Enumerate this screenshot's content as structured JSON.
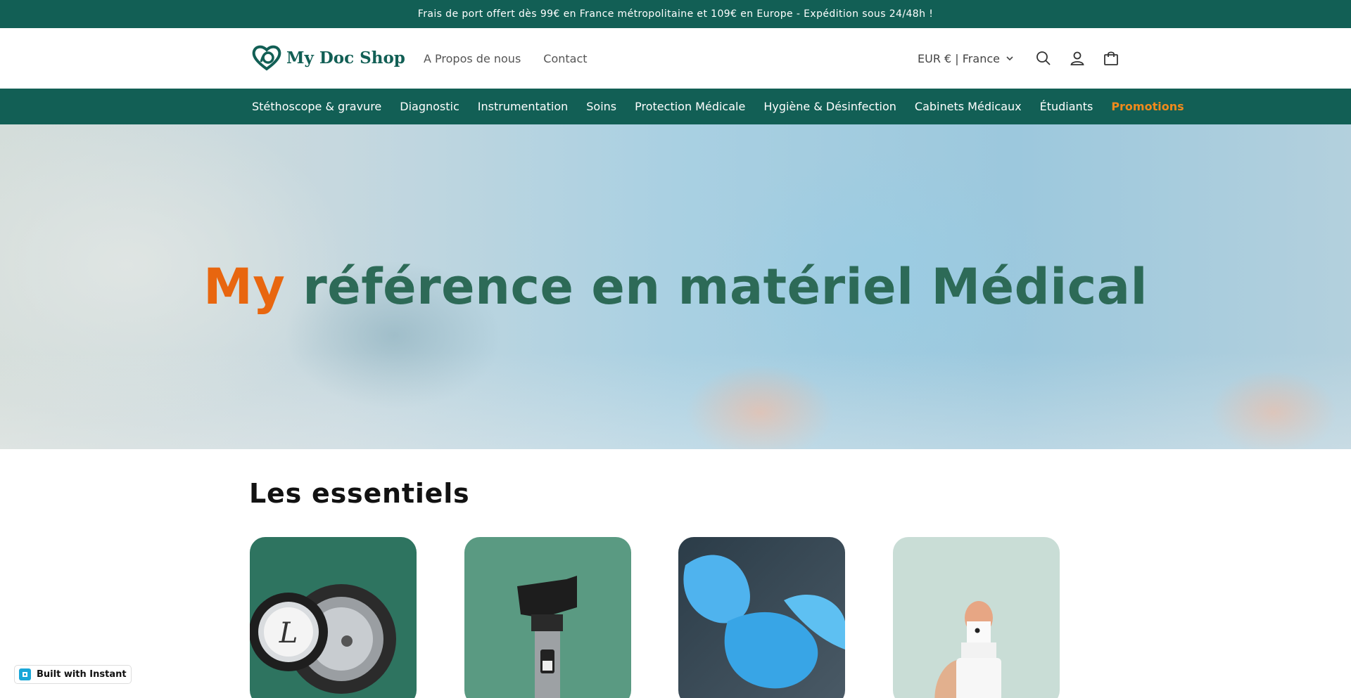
{
  "announcement": {
    "text": "Frais de port offert dès 99€ en France métropolitaine et 109€ en Europe - Expédition sous 24/48h !"
  },
  "header": {
    "logo_text": "My Doc Shop",
    "links": [
      {
        "label": "A Propos de nous"
      },
      {
        "label": "Contact"
      }
    ],
    "currency": "EUR € | France",
    "icons": [
      "search-icon",
      "account-icon",
      "cart-icon"
    ]
  },
  "nav": {
    "items": [
      {
        "label": "Stéthoscope & gravure"
      },
      {
        "label": "Diagnostic"
      },
      {
        "label": "Instrumentation"
      },
      {
        "label": "Soins"
      },
      {
        "label": "Protection Médicale"
      },
      {
        "label": "Hygiène & Désinfection"
      },
      {
        "label": "Cabinets Médicaux"
      },
      {
        "label": "Étudiants"
      },
      {
        "label": "Promotions"
      }
    ]
  },
  "hero": {
    "title_highlight": "My",
    "title_rest": " référence en matériel Médical"
  },
  "essentials": {
    "title": "Les essentiels"
  },
  "badge": {
    "label": "Built with Instant"
  },
  "colors": {
    "brand": "#125f55",
    "accent": "#e8660f",
    "promo": "#f08a1c"
  }
}
